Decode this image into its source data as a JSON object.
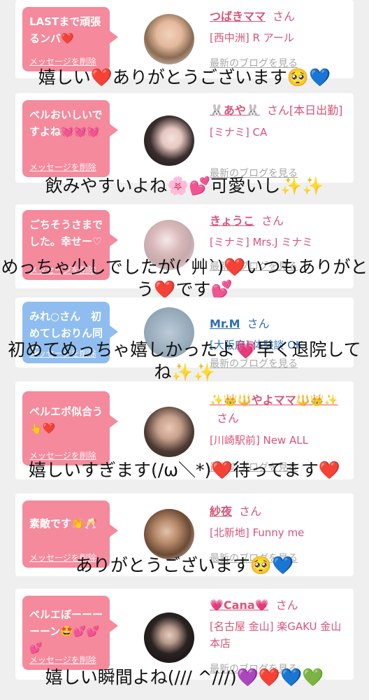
{
  "items": [
    {
      "bubble": "LASTまで頑張るンバ❤️",
      "delete": "メッセージを削除",
      "name": "つばきママ",
      "honorific": "さん",
      "shop": "[西中洲] R アール",
      "blog": "最新のブログを見る",
      "caption": "嬉しい❤️ありがとうございます🥺💙"
    },
    {
      "bubble": "ベルおいしいですよね💓💓💓",
      "delete": "メッセージを削除",
      "name": "🐰あや🐰",
      "honorific": "さん[本日出勤]",
      "shop": "[ミナミ] CA",
      "blog": "最新のブログを見る",
      "caption": "飲みやすいよね🌸💕可愛いし✨✨"
    },
    {
      "bubble": "ごちそうさまでした。幸せー♡",
      "delete": "メッセージを削除",
      "name": "きょうこ",
      "honorific": "さん",
      "shop": "[ミナミ] Mrs.J ミナミ",
      "blog": "最新のブログを見る",
      "caption": "めっちゃ少しでしたが(´艸`)❤️いつもありがとう❤️です💕"
    },
    {
      "bubble": "みれ○さん　初めてしおりん同じ",
      "delete": "メッセージを削除",
      "name": "Mr.M",
      "honorific": "さん",
      "shop": "[大阪府] 体験談 OK",
      "blog": "最新のブログを見る",
      "caption": "初めてめっちゃ嬉しかったよ💗早く退院してね✨✨"
    },
    {
      "bubble": "ベルエポ似合う👆❤️",
      "delete": "メッセージを削除",
      "name": "✨👑🔱やよママ🔱👑✨",
      "honorific": "さん",
      "shop": "[川崎駅前] New ALL",
      "blog": "最新のブログを見る",
      "caption": "嬉しいすぎます(/ω＼*)❤️待ってます❤️"
    },
    {
      "bubble": "素敵です👏🥂",
      "delete": "メッセージを削除",
      "name": "紗夜",
      "honorific": "さん",
      "shop": "[北新地] Funny me",
      "blog": "最新のブログを見る",
      "caption": "ありがとうございます🥺💙"
    },
    {
      "bubble": "ベルエぼーーーーーン🤩💕💕💕",
      "delete": "メッセージを削除",
      "name": "💗Cana💗",
      "honorific": "さん",
      "shop": "[名古屋 金山] 楽GAKU 金山本店",
      "blog": "最新のブログを見る",
      "caption": "嬉しい瞬間よね(/// ^///)💜❤️💙💚"
    }
  ],
  "colors": {
    "pink": "#f48a9c",
    "blue": "#8fbdf0",
    "name_pink": "#d95476",
    "name_blue": "#2e6fb3"
  }
}
